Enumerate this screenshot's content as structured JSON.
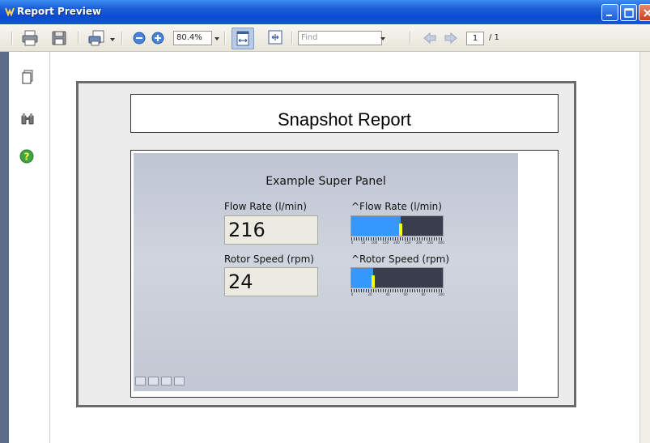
{
  "window": {
    "title": "Report Preview"
  },
  "toolbar": {
    "zoom_value": "80.4%",
    "find_placeholder": "Find",
    "page_current": "1",
    "page_total": "/ 1"
  },
  "report": {
    "title": "Snapshot Report",
    "panel": {
      "title": "Example Super Panel",
      "flow_rate_label": "Flow Rate (l/min)",
      "flow_rate_value": "216",
      "flow_gauge_label": "^Flow Rate (l/min)",
      "flow_gauge_fraction": 0.54,
      "flow_gauge_ticks": [
        "0",
        "50",
        "100",
        "150",
        "200",
        "250",
        "300",
        "350",
        "400"
      ],
      "rotor_label": "Rotor Speed (rpm)",
      "rotor_value": "24",
      "rotor_gauge_label": "^Rotor Speed (rpm)",
      "rotor_gauge_fraction": 0.24,
      "rotor_gauge_ticks": [
        "0",
        "20",
        "40",
        "60",
        "80",
        "100"
      ]
    }
  },
  "colors": {
    "titlebar": "#0b4bcf",
    "gauge_fill": "#3399ff",
    "gauge_bg": "#3a3d4e",
    "needle": "#ffff00"
  }
}
